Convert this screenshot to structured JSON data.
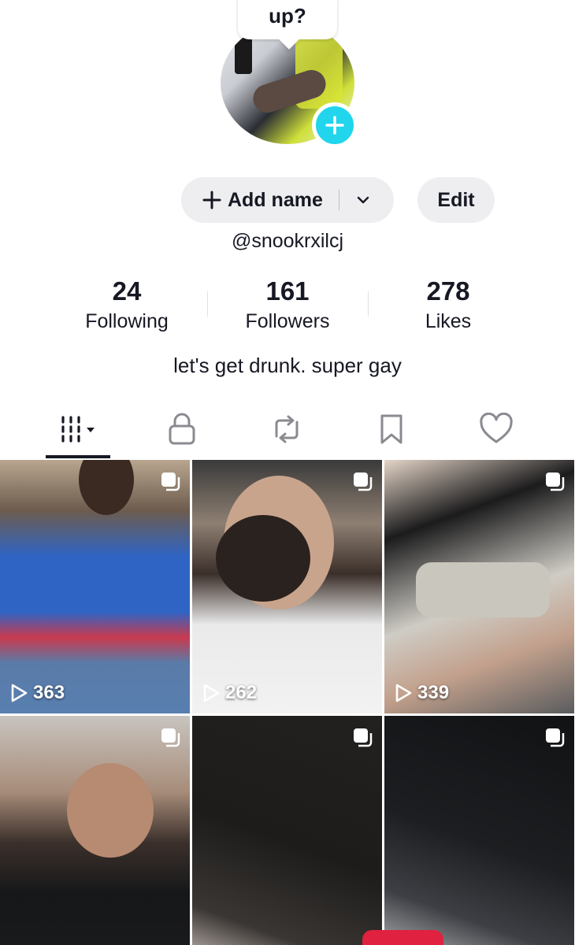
{
  "bubble": {
    "text": "up?"
  },
  "profile": {
    "add_name_label": "Add name",
    "edit_label": "Edit",
    "username": "@snookrxilcj",
    "bio": "let's get drunk. super gay"
  },
  "stats": [
    {
      "num": "24",
      "label": "Following"
    },
    {
      "num": "161",
      "label": "Followers"
    },
    {
      "num": "278",
      "label": "Likes"
    }
  ],
  "tabs": [
    {
      "icon": "grid-videos-icon",
      "active": true
    },
    {
      "icon": "lock-icon",
      "active": false
    },
    {
      "icon": "repost-icon",
      "active": false
    },
    {
      "icon": "bookmark-icon",
      "active": false
    },
    {
      "icon": "heart-icon",
      "active": false
    }
  ],
  "videos": [
    {
      "views": "363",
      "multi": true
    },
    {
      "views": "262",
      "multi": true
    },
    {
      "views": "339",
      "multi": true
    },
    {
      "views": "",
      "multi": true
    },
    {
      "views": "",
      "multi": true
    },
    {
      "views": "",
      "multi": true
    }
  ],
  "colors": {
    "accent": "#20d5ec",
    "text": "#161823",
    "button_bg": "#eeeef0",
    "red": "#e0213f"
  }
}
